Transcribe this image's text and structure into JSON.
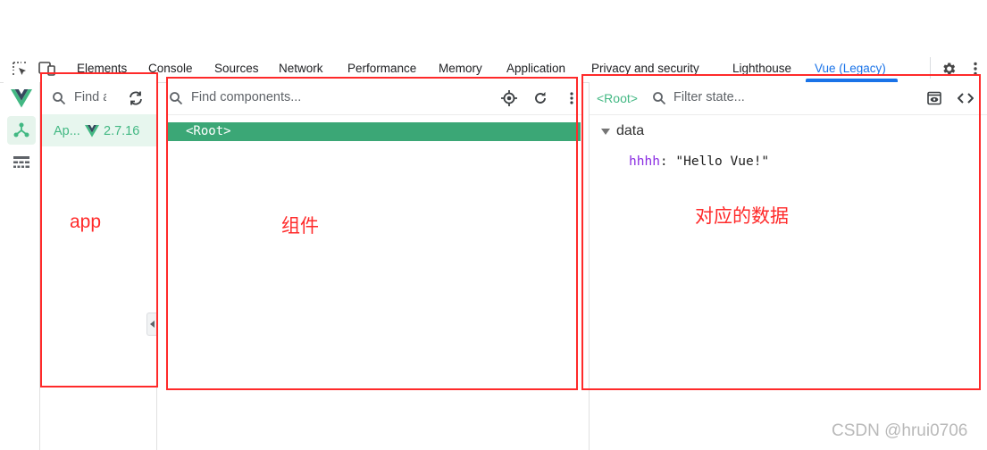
{
  "tabs": [
    {
      "label": "Elements"
    },
    {
      "label": "Console"
    },
    {
      "label": "Sources"
    },
    {
      "label": "Network"
    },
    {
      "label": "Performance"
    },
    {
      "label": "Memory"
    },
    {
      "label": "Application"
    },
    {
      "label": "Privacy and security"
    },
    {
      "label": "Lighthouse"
    },
    {
      "label": "Vue (Legacy)"
    }
  ],
  "apps_pane": {
    "search_placeholder": "Find a",
    "app_name": "Ap...",
    "app_version": "2.7.16"
  },
  "components_pane": {
    "search_placeholder": "Find components...",
    "root_label": "<Root>"
  },
  "state_pane": {
    "breadcrumb": "<Root>",
    "search_placeholder": "Filter state...",
    "section": "data",
    "prop_key": "hhhh",
    "prop_sep": ":",
    "prop_value": "\"Hello Vue!\""
  },
  "annotations": {
    "app": "app",
    "components": "组件",
    "data": "对应的数据"
  },
  "watermark": "CSDN @hrui0706",
  "colors": {
    "vue_green": "#42b883",
    "selected_row": "#3ba776",
    "annotation_red": "#ff2a2a",
    "active_tab": "#1a73e8",
    "prop_key": "#8a2be2"
  },
  "icons": [
    "inspect-element-icon",
    "device-toolbar-icon",
    "settings-icon",
    "more-vert-icon",
    "vue-logo-icon",
    "component-tree-icon",
    "timeline-icon",
    "search-icon",
    "refresh-icon",
    "target-icon",
    "reload-icon",
    "eye-icon",
    "code-icon",
    "collapse-arrow-icon",
    "triangle-down-icon"
  ]
}
